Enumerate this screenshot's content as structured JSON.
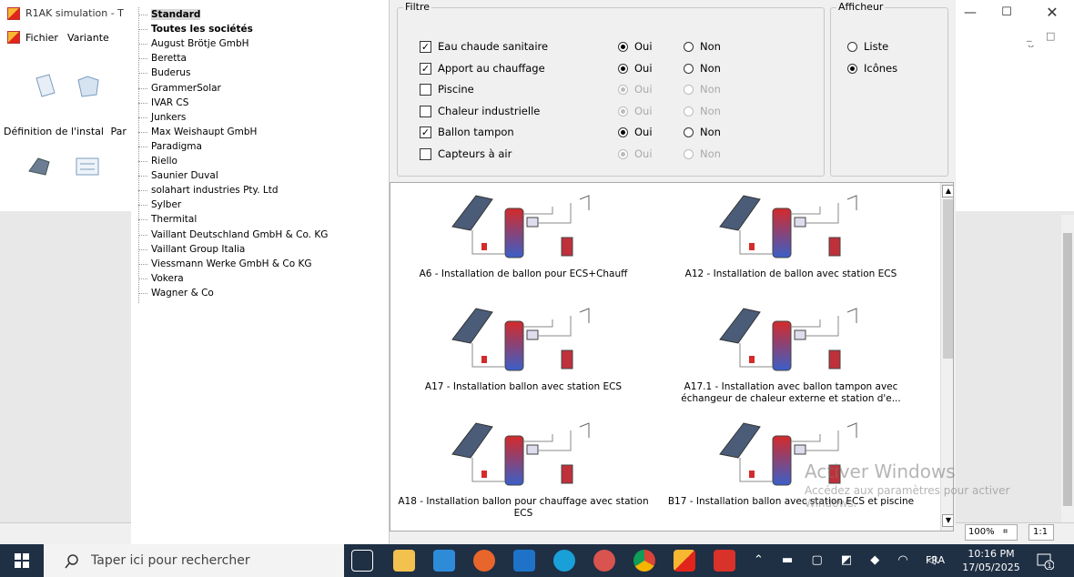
{
  "app": {
    "title": "R1AK simulation - T",
    "menu": [
      "Fichier",
      "Variante"
    ],
    "toolbar_label_1": "Définition de l'instal",
    "toolbar_label_2": "Par",
    "zoom": "100%",
    "ratio": "1:1"
  },
  "tree": {
    "items": [
      "Standard",
      "Toutes les sociétés",
      "August Brötje GmbH",
      "Beretta",
      "Buderus",
      "GrammerSolar",
      "IVAR CS",
      "Junkers",
      "Max Weishaupt GmbH",
      "Paradigma",
      "Riello",
      "Saunier Duval",
      "solahart industries Pty. Ltd",
      "Sylber",
      "Thermital",
      "Vaillant Deutschland GmbH & Co. KG",
      "Vaillant Group Italia",
      "Viessmann Werke GmbH & Co KG",
      "Vokera",
      "Wagner & Co"
    ]
  },
  "filtre": {
    "legend": "Filtre",
    "rows": [
      {
        "label": "Eau chaude sanitaire",
        "checked": true,
        "oui": "Oui",
        "non": "Non",
        "enabled": true,
        "selected": "oui"
      },
      {
        "label": "Apport au chauffage",
        "checked": true,
        "oui": "Oui",
        "non": "Non",
        "enabled": true,
        "selected": "oui"
      },
      {
        "label": "Piscine",
        "checked": false,
        "oui": "Oui",
        "non": "Non",
        "enabled": false,
        "selected": "oui"
      },
      {
        "label": "Chaleur industrielle",
        "checked": false,
        "oui": "Oui",
        "non": "Non",
        "enabled": false,
        "selected": "oui"
      },
      {
        "label": "Ballon tampon",
        "checked": true,
        "oui": "Oui",
        "non": "Non",
        "enabled": true,
        "selected": "oui"
      },
      {
        "label": "Capteurs à air",
        "checked": false,
        "oui": "Oui",
        "non": "Non",
        "enabled": false,
        "selected": "oui"
      }
    ]
  },
  "afficheur": {
    "legend": "Afficheur",
    "options": [
      {
        "label": "Liste",
        "selected": false
      },
      {
        "label": "Icônes",
        "selected": true
      }
    ]
  },
  "gallery": {
    "items": [
      {
        "caption": "A6 - Installation de ballon pour ECS+Chauff"
      },
      {
        "caption": "A12 - Installation de ballon avec station ECS"
      },
      {
        "caption": "A17 - Installation ballon avec station ECS"
      },
      {
        "caption": "A17.1 - Installation avec ballon tampon avec échangeur de chaleur externe et station d'e..."
      },
      {
        "caption": "A18 - Installation ballon pour chauffage avec station ECS"
      },
      {
        "caption": "B17 - Installation ballon avec station ECS et piscine"
      }
    ]
  },
  "watermark": {
    "line1": "Activer Windows",
    "line2": "Accédez aux paramètres pour activer Windows."
  },
  "taskbar": {
    "search_placeholder": "Taper ici pour rechercher",
    "lang": "FRA",
    "time": "10:16 PM",
    "date": "17/05/2025",
    "notif_count": "1"
  }
}
